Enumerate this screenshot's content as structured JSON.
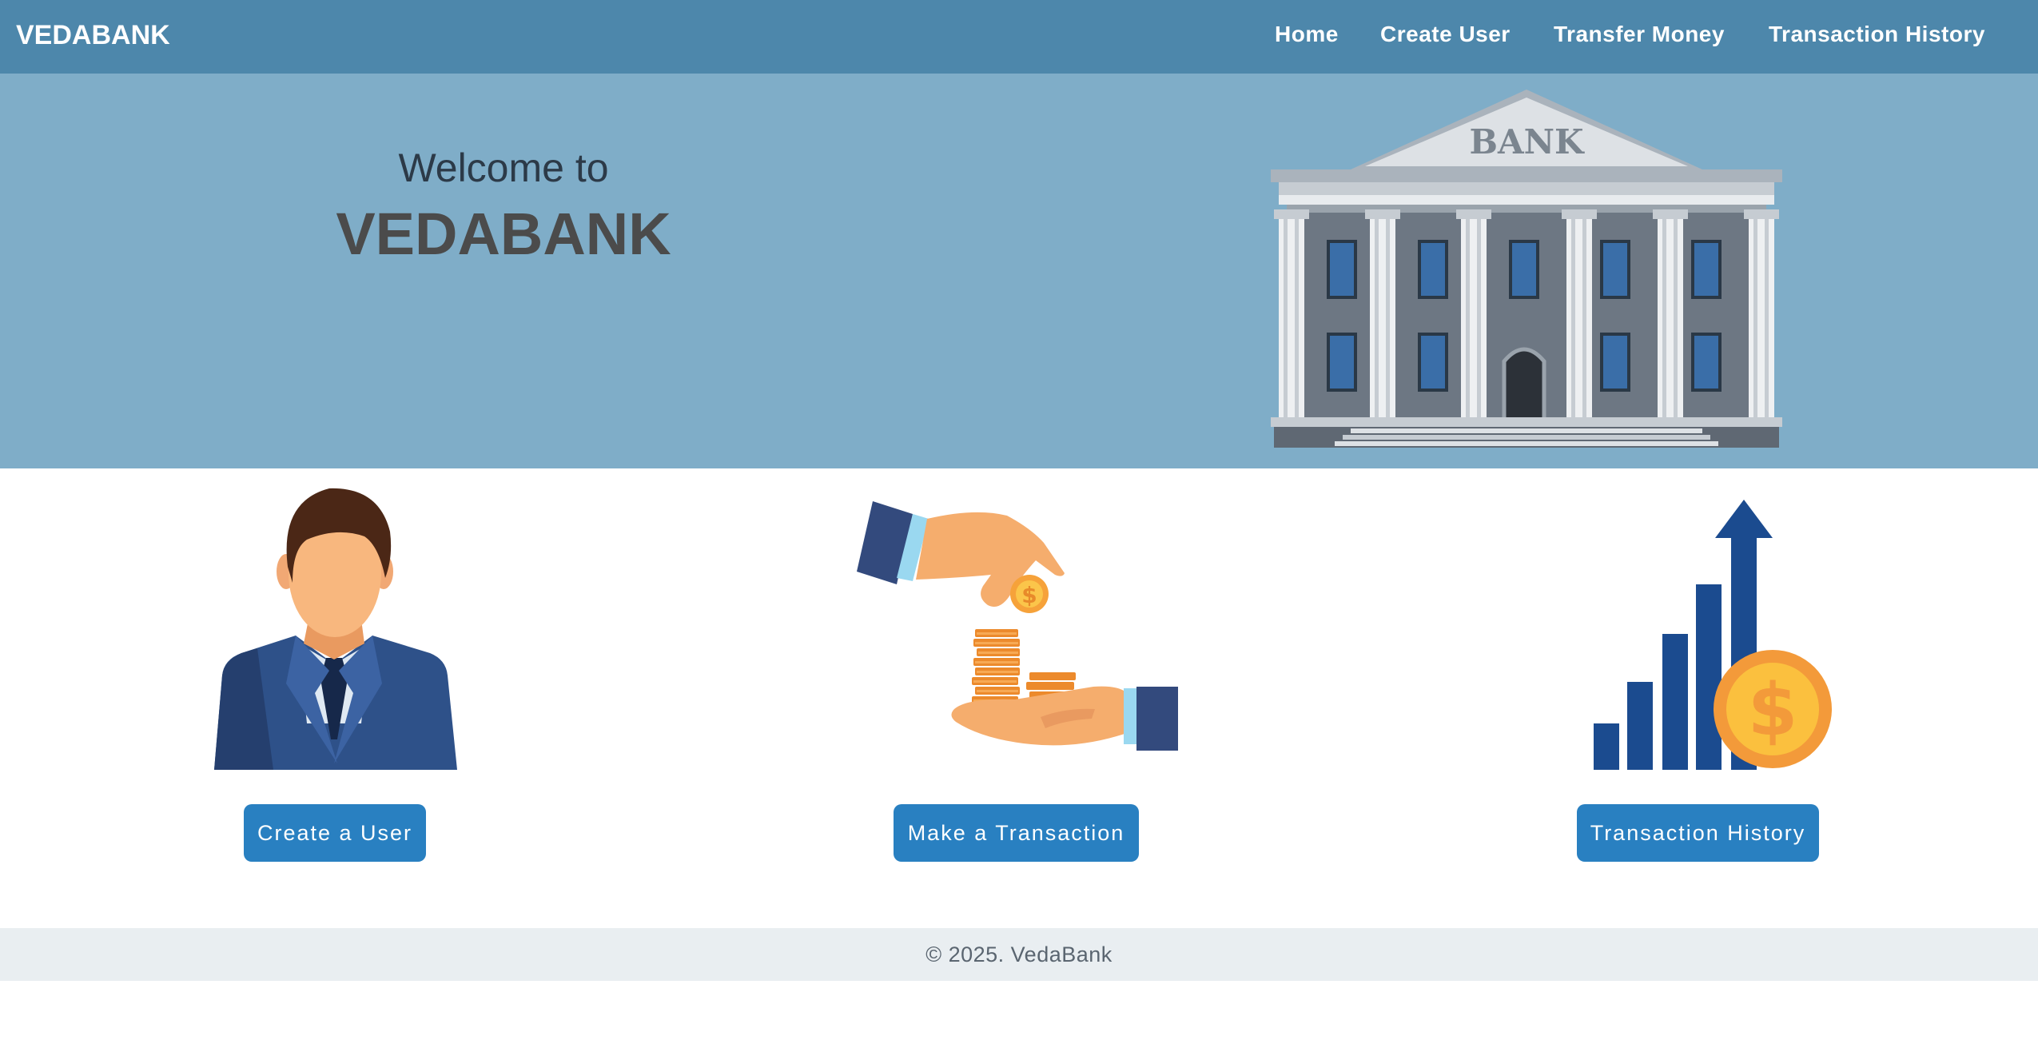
{
  "navbar": {
    "brand": "VEDABANK",
    "links": [
      {
        "label": "Home"
      },
      {
        "label": "Create User"
      },
      {
        "label": "Transfer Money"
      },
      {
        "label": "Transaction History"
      }
    ],
    "background": "#4d87ab"
  },
  "hero": {
    "welcome": "Welcome to",
    "title": "VEDABANK",
    "image_sign": "BANK",
    "background": "#7fadc8"
  },
  "cards": [
    {
      "icon": "businessman-icon",
      "button": "Create a User"
    },
    {
      "icon": "coin-hands-icon",
      "button": "Make a Transaction"
    },
    {
      "icon": "growth-chart-icon",
      "button": "Transaction History"
    }
  ],
  "footer": {
    "text": "© 2025. VedaBank"
  },
  "colors": {
    "accent": "#2980c1",
    "navy": "#2e4f86",
    "coin": "#f39a3a"
  }
}
